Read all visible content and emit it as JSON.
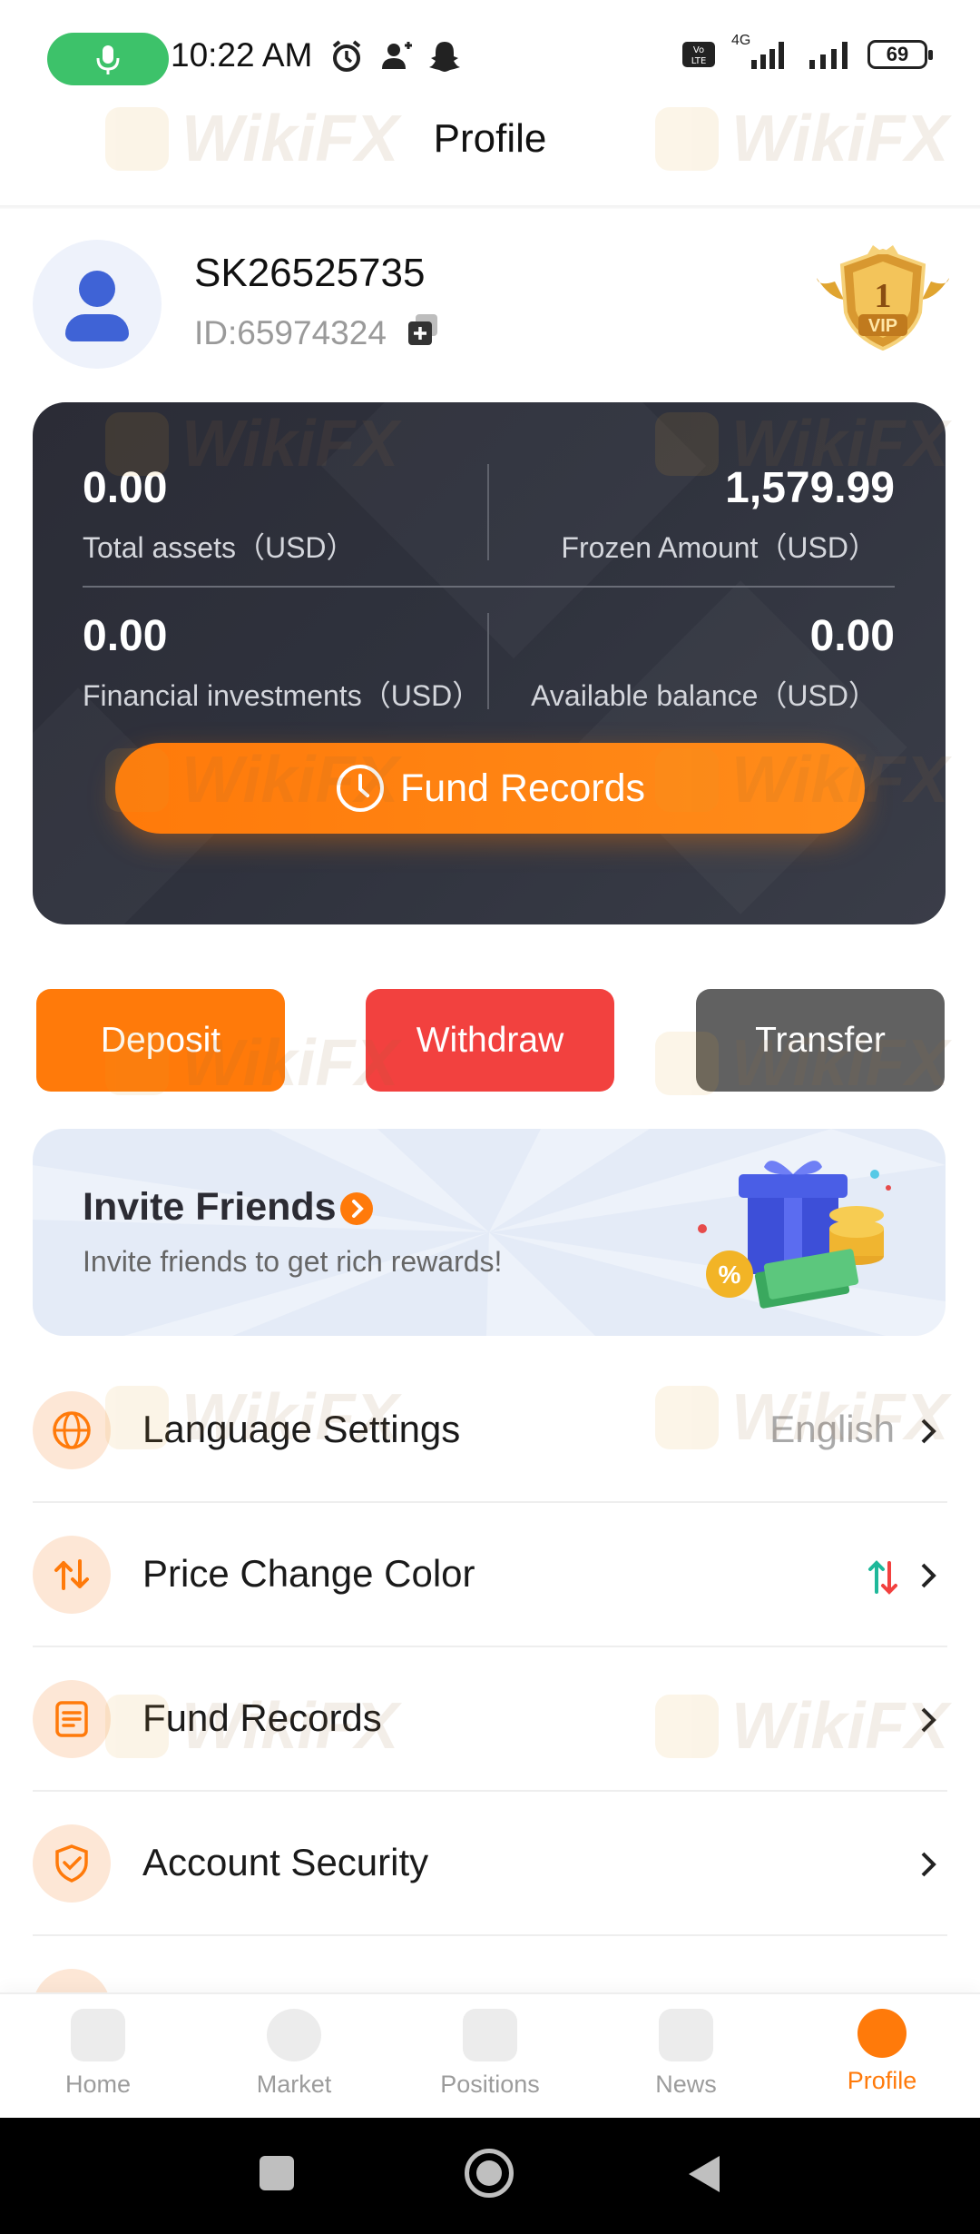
{
  "status_bar": {
    "time": "10:22 AM",
    "battery": "69",
    "network": "4G"
  },
  "header": {
    "title": "Profile"
  },
  "profile": {
    "username": "SK26525735",
    "user_id": "ID:65974324",
    "vip_level": "1",
    "vip_label": "VIP"
  },
  "assets": {
    "total_assets_value": "0.00",
    "total_assets_label": "Total assets（USD）",
    "frozen_value": "1,579.99",
    "frozen_label": "Frozen Amount（USD）",
    "financial_value": "0.00",
    "financial_label": "Financial investments（USD）",
    "available_value": "0.00",
    "available_label": "Available balance（USD）",
    "fund_records_button": "Fund Records"
  },
  "actions": {
    "deposit": "Deposit",
    "withdraw": "Withdraw",
    "transfer": "Transfer"
  },
  "invite": {
    "title": "Invite Friends",
    "subtitle": "Invite friends to get rich rewards!"
  },
  "menu": [
    {
      "label": "Language Settings",
      "value": "English",
      "icon": "globe-icon"
    },
    {
      "label": "Price Change Color",
      "value": "",
      "icon": "swap-arrows-icon"
    },
    {
      "label": "Fund Records",
      "value": "",
      "icon": "document-list-icon"
    },
    {
      "label": "Account Security",
      "value": "",
      "icon": "shield-check-icon"
    }
  ],
  "tabs": [
    {
      "label": "Home",
      "active": false
    },
    {
      "label": "Market",
      "active": false
    },
    {
      "label": "Positions",
      "active": false
    },
    {
      "label": "News",
      "active": false
    },
    {
      "label": "Profile",
      "active": true
    }
  ],
  "watermark_text": "WikiFX",
  "colors": {
    "accent": "#ff7a0a",
    "withdraw": "#f2413f",
    "transfer": "#616161",
    "card": "#2f323d",
    "up": "#1fb89a",
    "down": "#f2413f"
  }
}
